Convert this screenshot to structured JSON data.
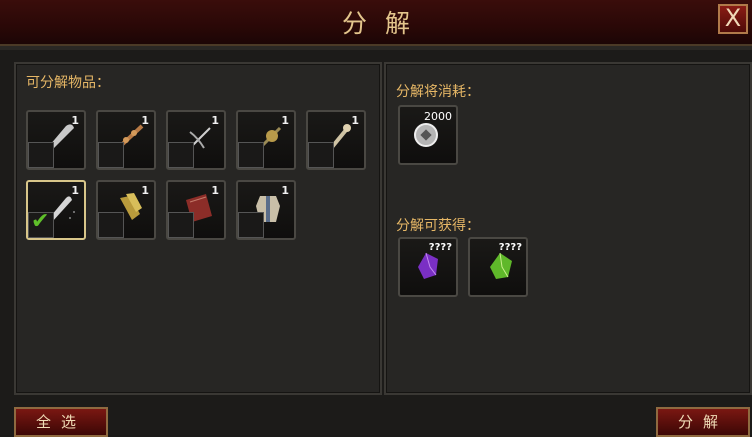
{
  "window": {
    "title": "分解",
    "close_label": "X"
  },
  "left_panel": {
    "heading": "可分解物品：",
    "items": [
      {
        "name": "scythe-blade",
        "count": "1",
        "checked": false
      },
      {
        "name": "bone-spear",
        "count": "1",
        "checked": false
      },
      {
        "name": "hook-staff",
        "count": "1",
        "checked": false
      },
      {
        "name": "gold-flail",
        "count": "1",
        "checked": false
      },
      {
        "name": "torch-club",
        "count": "1",
        "checked": false
      },
      {
        "name": "dark-scythe",
        "count": "1",
        "checked": true
      },
      {
        "name": "golden-boots",
        "count": "1",
        "checked": false
      },
      {
        "name": "red-tome",
        "count": "1",
        "checked": false
      },
      {
        "name": "robe-armor",
        "count": "1",
        "checked": false
      }
    ]
  },
  "right_panel": {
    "cost_heading": "分解将消耗：",
    "cost": {
      "icon": "silver-coin-icon",
      "amount": "2000"
    },
    "gain_heading": "分解可获得：",
    "gains": [
      {
        "icon": "purple-crystal-icon",
        "amount": "????"
      },
      {
        "icon": "green-gem-icon",
        "amount": "????"
      }
    ]
  },
  "buttons": {
    "select_all": "全选",
    "decompose": "分解"
  },
  "colors": {
    "accent_gold": "#e6b766",
    "button_red": "#7a1712",
    "check_green": "#5fbf2a"
  }
}
